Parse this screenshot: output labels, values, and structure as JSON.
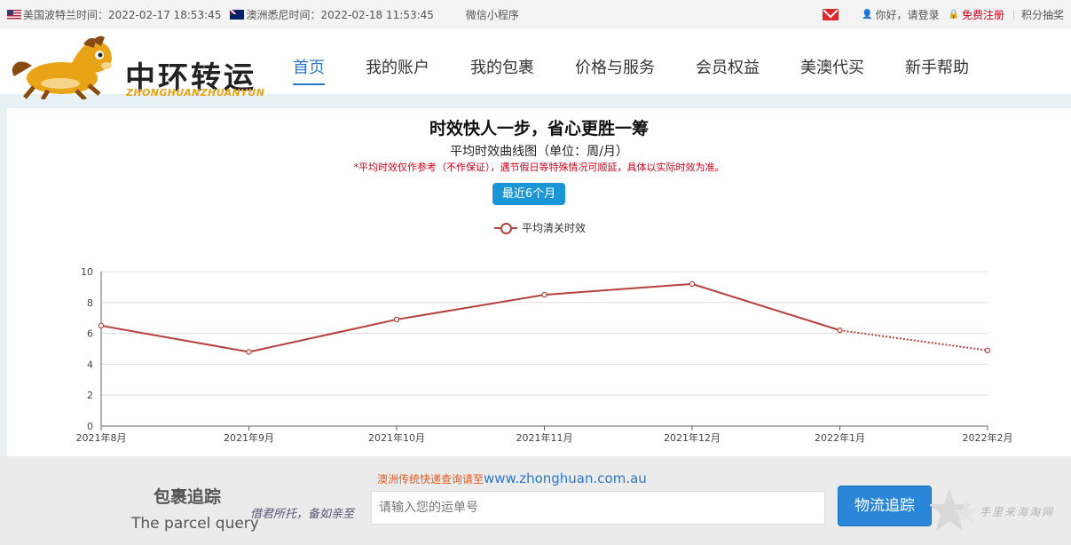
{
  "topbar": {
    "us_clock": "美国波特兰时间：2022-02-17 18:53:45",
    "au_clock": "澳洲悉尼时间：2022-02-18 11:53:45",
    "wechat": "微信小程序",
    "login": "你好，请登录",
    "register": "免费注册",
    "points": "积分抽奖"
  },
  "logo": {
    "cn": "中环转运",
    "en": "ZHONGHUANZHUANYUN"
  },
  "nav": {
    "items": [
      {
        "label": "首页",
        "active": true
      },
      {
        "label": "我的账户"
      },
      {
        "label": "我的包裹"
      },
      {
        "label": "价格与服务"
      },
      {
        "label": "会员权益"
      },
      {
        "label": "美澳代买"
      },
      {
        "label": "新手帮助"
      }
    ]
  },
  "panel": {
    "title": "时效快人一步，省心更胜一筹",
    "subtitle": "平均时效曲线图（单位：周/月）",
    "note": "*平均时效仅作参考（不作保证），遇节假日等特殊情况可顺延，具体以实际时效为准。",
    "range_button": "最近6个月"
  },
  "chart_data": {
    "type": "line",
    "categories": [
      "2021年8月",
      "2021年9月",
      "2021年10月",
      "2021年11月",
      "2021年12月",
      "2022年1月",
      "2022年2月"
    ],
    "series": [
      {
        "name": "平均清关时效",
        "values": [
          6.5,
          4.8,
          6.9,
          8.5,
          9.2,
          6.2,
          4.9
        ],
        "color": "#b5403c",
        "dashed_last_segment": true
      }
    ],
    "yticks": [
      "0",
      "2",
      "4",
      "6",
      "8",
      "10"
    ],
    "ylim": [
      0,
      10
    ],
    "grid": true,
    "legend": "top-center"
  },
  "footer": {
    "track_title": "包裹追踪",
    "track_en": "The parcel query",
    "slogan": "借君所托，备如亲至",
    "query_tip": "澳洲传统快递查询请至",
    "query_url": "www.zhonghuan.com.au",
    "input_placeholder": "请输入您的运单号",
    "track_button": "物流追踪",
    "watermark": "手里来海淘网"
  }
}
